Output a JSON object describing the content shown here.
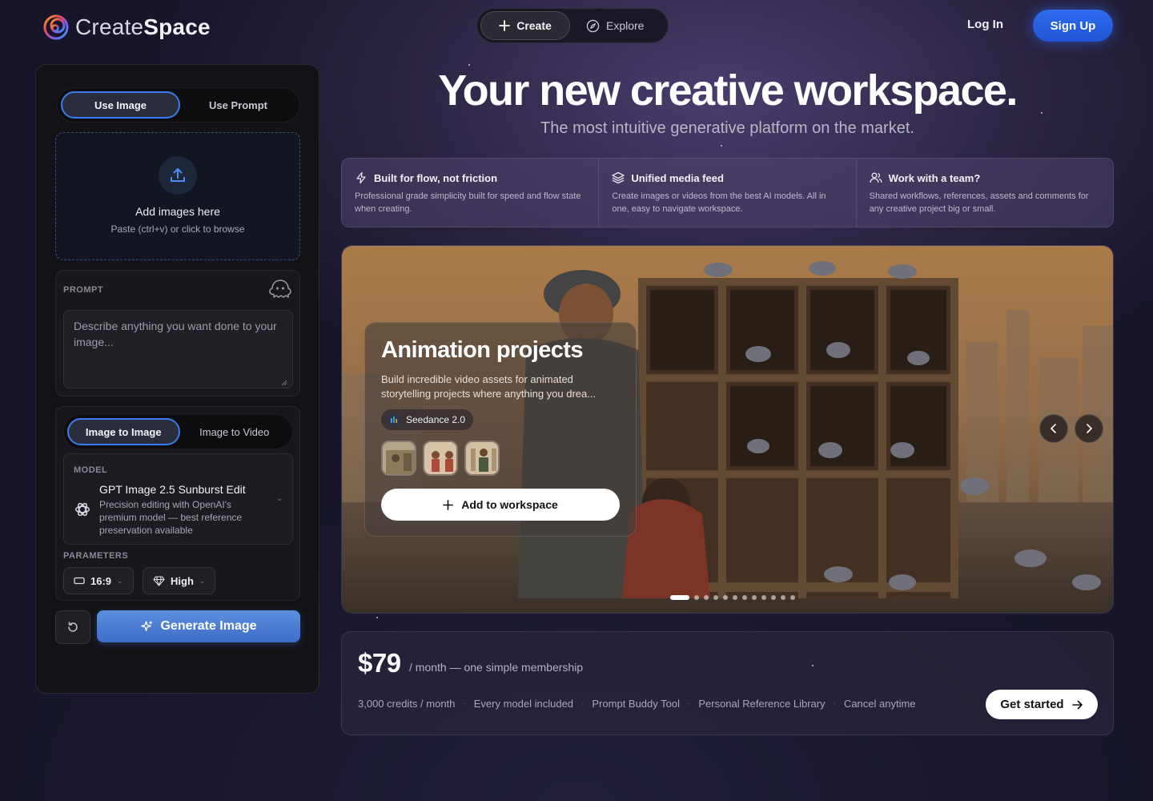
{
  "brand": {
    "name_light": "Create",
    "name_bold": "Space"
  },
  "nav": {
    "create_label": "Create",
    "explore_label": "Explore",
    "login_label": "Log In",
    "signup_label": "Sign Up"
  },
  "left_panel": {
    "mode_tabs": [
      "Use Image",
      "Use Prompt"
    ],
    "active_mode": "Use Image",
    "dropzone": {
      "title": "Add images here",
      "subtitle": "Paste (ctrl+v) or click to browse"
    },
    "prompt": {
      "label": "PROMPT",
      "placeholder": "Describe anything you want done to your image...",
      "value": ""
    },
    "gen_tabs": [
      "Image to Image",
      "Image to Video"
    ],
    "active_gen_tab": "Image to Image",
    "model": {
      "label": "MODEL",
      "name": "GPT Image 2.5 Sunburst Edit",
      "description": "Precision editing with OpenAI's premium model — best reference preservation available"
    },
    "parameters": {
      "label": "PARAMETERS",
      "aspect_ratio": "16:9",
      "quality": "High"
    },
    "generate_label": "Generate Image"
  },
  "hero": {
    "title": "Your new creative workspace.",
    "subtitle": "The most intuitive generative platform on the market."
  },
  "features": [
    {
      "icon": "bolt-icon",
      "title": "Built for flow, not friction",
      "description": "Professional grade simplicity built for speed and flow state when creating."
    },
    {
      "icon": "layers-icon",
      "title": "Unified media feed",
      "description": "Create images or videos from the best AI models. All in one, easy to navigate workspace."
    },
    {
      "icon": "users-icon",
      "title": "Work with a team?",
      "description": "Shared workflows, references, assets and comments for any creative project big or small."
    }
  ],
  "showcase": {
    "title": "Animation projects",
    "description": "Build incredible video assets for animated storytelling projects where anything you drea...",
    "model_badge": "Seedance 2.0",
    "add_label": "Add to workspace",
    "slide_count": 12,
    "active_slide": 1
  },
  "pricing": {
    "price": "$79",
    "period": "/ month — one simple membership",
    "perks": [
      "3,000 credits / month",
      "Every model included",
      "Prompt Buddy Tool",
      "Personal Reference Library",
      "Cancel anytime"
    ],
    "cta_label": "Get started"
  },
  "colors": {
    "accent": "#3a7bf0",
    "signup": "#2f6cf0",
    "generate": "#4e7fd6"
  }
}
